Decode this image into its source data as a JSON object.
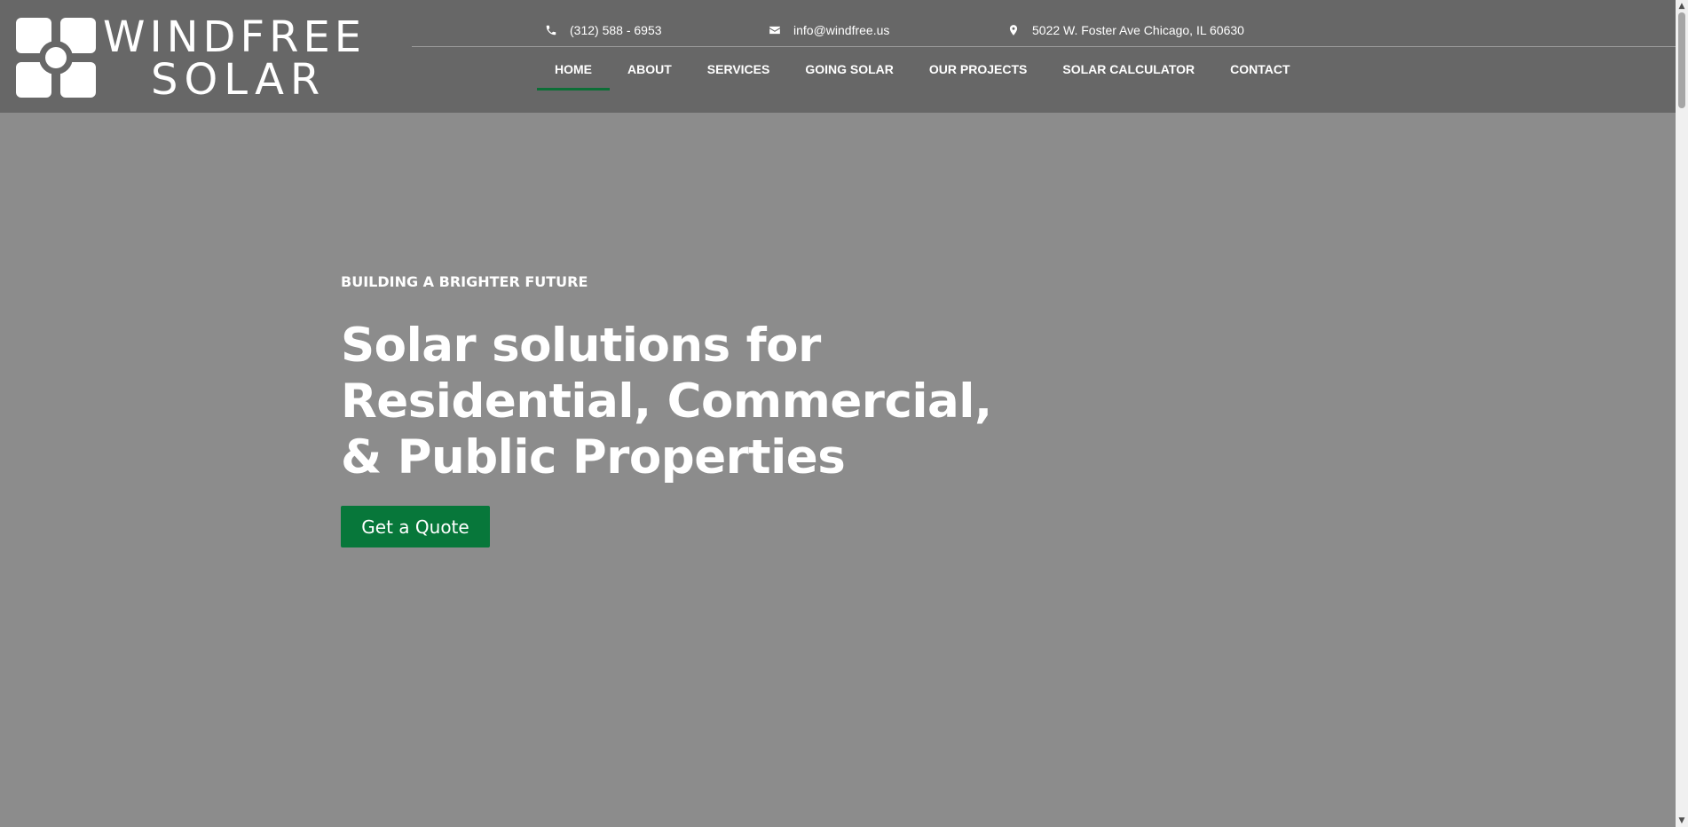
{
  "brand": {
    "line1": "WINDFREE",
    "line2": "SOLAR"
  },
  "contact": {
    "phone": "(312) 588 - 6953",
    "email": "info@windfree.us",
    "address": "5022 W. Foster Ave Chicago, IL 60630"
  },
  "nav": {
    "items": [
      {
        "label": "HOME",
        "active": true
      },
      {
        "label": "ABOUT"
      },
      {
        "label": "SERVICES"
      },
      {
        "label": "GOING SOLAR"
      },
      {
        "label": "OUR PROJECTS"
      },
      {
        "label": "SOLAR CALCULATOR"
      },
      {
        "label": "CONTACT"
      }
    ]
  },
  "hero": {
    "eyebrow": "BUILDING A BRIGHTER FUTURE",
    "headline": "Solar solutions for Residential, Commercial, & Public Properties",
    "cta_label": "Get a Quote"
  },
  "colors": {
    "header_bg": "#676767",
    "hero_bg": "#8c8c8c",
    "accent_green": "#07773a"
  },
  "icons": [
    "phone-icon",
    "envelope-icon",
    "map-pin-icon"
  ]
}
